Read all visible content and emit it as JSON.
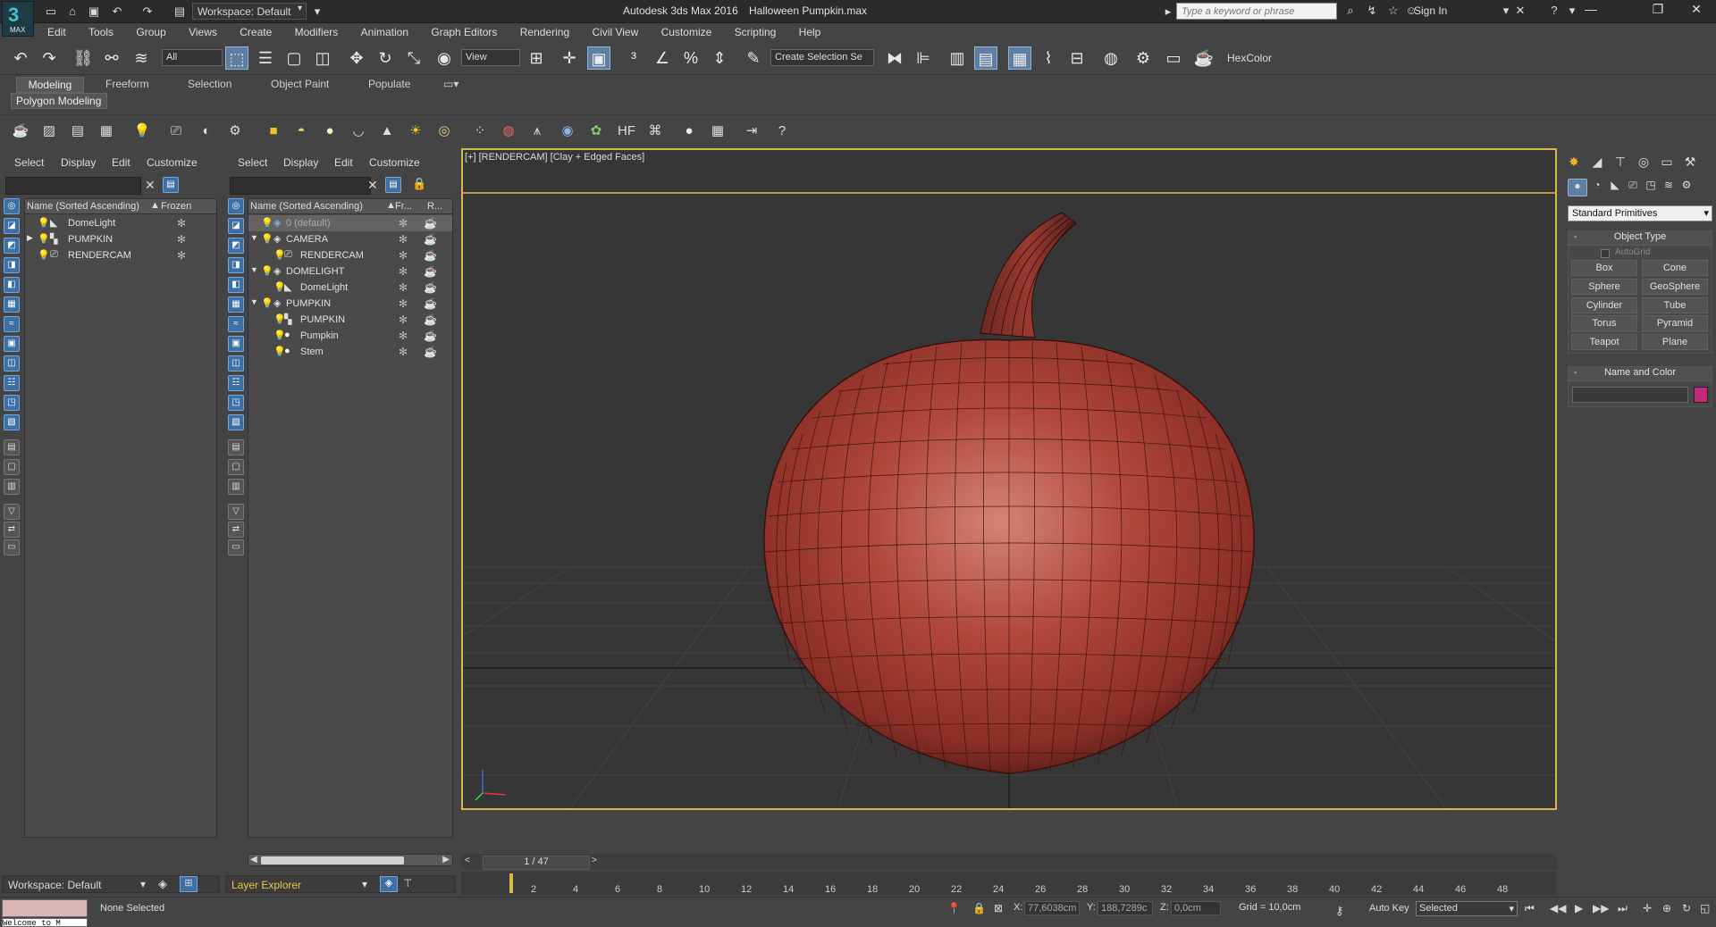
{
  "title_bar": {
    "app_title": "Autodesk 3ds Max 2016",
    "file_name": "Halloween Pumpkin.max",
    "workspace_label": "Workspace: Default",
    "search_placeholder": "Type a keyword or phrase",
    "sign_in": "Sign In",
    "logo_text": "MAX"
  },
  "menu": [
    "Edit",
    "Tools",
    "Group",
    "Views",
    "Create",
    "Modifiers",
    "Animation",
    "Graph Editors",
    "Rendering",
    "Civil View",
    "Customize",
    "Scripting",
    "Help"
  ],
  "main_toolbar": {
    "selection_filter": "All",
    "ref_coord": "View",
    "named_selection": "Create Selection Se",
    "hexcolor_label": "HexColor"
  },
  "ribbon": {
    "tabs": [
      "Modeling",
      "Freeform",
      "Selection",
      "Object Paint",
      "Populate"
    ],
    "active_tab": "Modeling",
    "panel_label": "Polygon Modeling"
  },
  "scene_explorer": {
    "menu": [
      "Select",
      "Display",
      "Edit",
      "Customize"
    ],
    "col_name": "Name (Sorted Ascending)",
    "col_frozen": "Frozen",
    "rows": [
      {
        "name": "DomeLight"
      },
      {
        "name": "PUMPKIN"
      },
      {
        "name": "RENDERCAM"
      }
    ],
    "workspace_footer": "Workspace: Default"
  },
  "layer_explorer": {
    "menu": [
      "Select",
      "Display",
      "Edit",
      "Customize"
    ],
    "col_name": "Name (Sorted Ascending)",
    "col_frozen": "Fr...",
    "col_render": "R...",
    "rows": [
      {
        "name": "0 (default)",
        "level": 0
      },
      {
        "name": "CAMERA",
        "level": 0
      },
      {
        "name": "RENDERCAM",
        "level": 1
      },
      {
        "name": "DOMELIGHT",
        "level": 0
      },
      {
        "name": "DomeLight",
        "level": 1
      },
      {
        "name": "PUMPKIN",
        "level": 0
      },
      {
        "name": "PUMPKIN",
        "level": 1
      },
      {
        "name": "Pumpkin",
        "level": 1
      },
      {
        "name": "Stem",
        "level": 1
      }
    ],
    "footer": "Layer Explorer"
  },
  "viewport": {
    "label": "[+] [RENDERCAM] [Clay + Edged Faces]",
    "frame_counter": "1 / 47"
  },
  "command_panel": {
    "category": "Standard Primitives",
    "object_type_title": "Object Type",
    "autogrid": "AutoGrid",
    "buttons": [
      "Box",
      "Cone",
      "Sphere",
      "GeoSphere",
      "Cylinder",
      "Tube",
      "Torus",
      "Pyramid",
      "Teapot",
      "Plane"
    ],
    "name_color_title": "Name and Color",
    "swatch_color": "#c3287a"
  },
  "timeline": {
    "ticks": [
      "2",
      "4",
      "6",
      "8",
      "10",
      "12",
      "14",
      "16",
      "18",
      "20",
      "22",
      "24",
      "26",
      "28",
      "30",
      "32",
      "34",
      "36",
      "38",
      "40",
      "42",
      "44",
      "46",
      "48"
    ]
  },
  "status": {
    "selection": "None Selected",
    "script_listener": "Welcome to M",
    "x_label": "X:",
    "x_value": "77,6038cm",
    "y_label": "Y:",
    "y_value": "188,7289c",
    "z_label": "Z:",
    "z_value": "0,0cm",
    "grid": "Grid = 10,0cm",
    "auto_key": "Auto Key",
    "key_filter": "Selected"
  }
}
